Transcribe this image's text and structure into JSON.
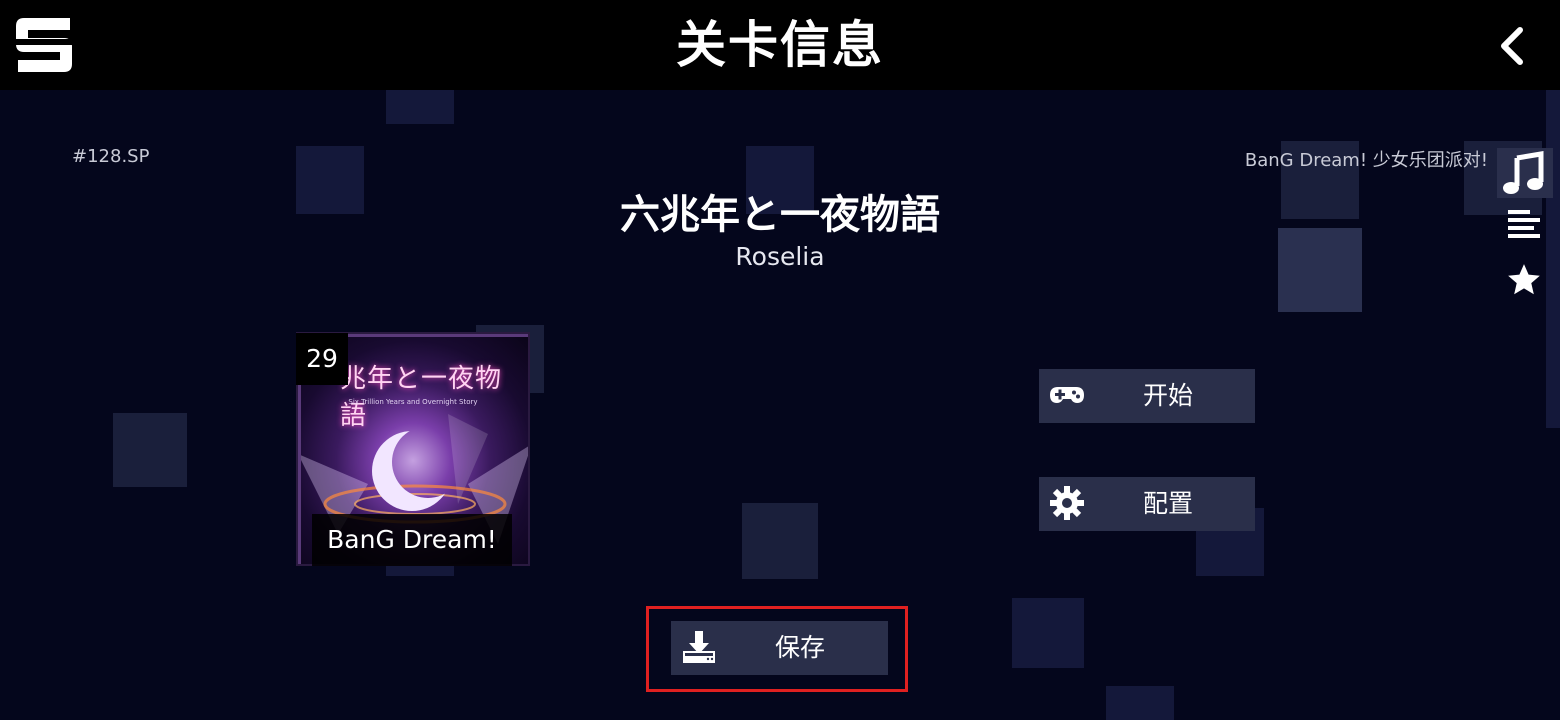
{
  "header": {
    "title": "关卡信息",
    "logo_icon": "s-logo-icon",
    "back_icon": "chevron-left-icon"
  },
  "level": {
    "id": "#128.SP",
    "pack": "BanG Dream! 少女乐团派对!",
    "title": "六兆年と一夜物語",
    "artist": "Roselia",
    "difficulty": "29",
    "cover_label": "BanG Dream!",
    "cover_art_title": "兆年と一夜物語",
    "cover_art_subtitle": "Six Trillion Years and Overnight Story"
  },
  "side_menu": {
    "icons": [
      "music-note-icon",
      "list-icon",
      "star-icon"
    ]
  },
  "actions": {
    "start_label": "开始",
    "config_label": "配置",
    "save_label": "保存"
  },
  "colors": {
    "background": "#04061c",
    "topbar": "#000000",
    "button": "#2a2f4a",
    "highlight": "#e02020"
  }
}
